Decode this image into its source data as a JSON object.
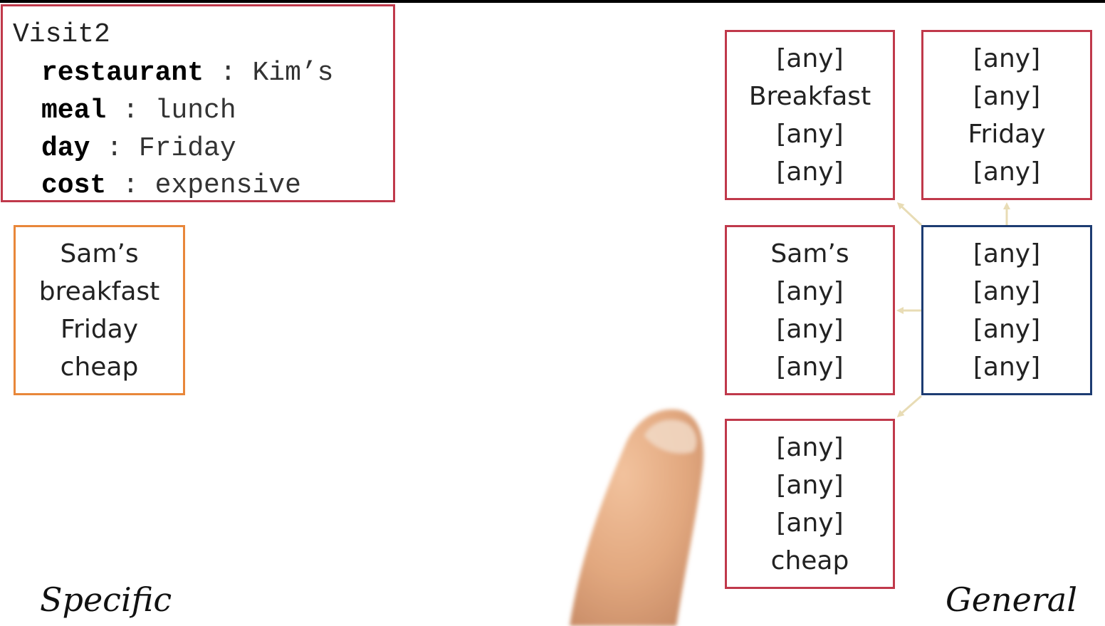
{
  "visit": {
    "title": "Visit2",
    "fields": [
      {
        "key": "restaurant",
        "value": "Kim’s"
      },
      {
        "key": "meal",
        "value": "lunch"
      },
      {
        "key": "day",
        "value": "Friday"
      },
      {
        "key": "cost",
        "value": "expensive"
      }
    ]
  },
  "specific_box": [
    "Sam’s",
    "breakfast",
    "Friday",
    "cheap"
  ],
  "general": {
    "top_left": [
      "[any]",
      "Breakfast",
      "[any]",
      "[any]"
    ],
    "top_right": [
      "[any]",
      "[any]",
      "Friday",
      "[any]"
    ],
    "mid_left": [
      "Sam’s",
      "[any]",
      "[any]",
      "[any]"
    ],
    "mid_right": [
      "[any]",
      "[any]",
      "[any]",
      "[any]"
    ],
    "bottom_left": [
      "[any]",
      "[any]",
      "[any]",
      "cheap"
    ]
  },
  "labels": {
    "specific": "Specific",
    "general": "General"
  },
  "colors": {
    "hypothesis_border": "#c0394b",
    "most_general_border": "#1d3c72",
    "specific_border": "#e8873a",
    "arrow": "#e8dcb5",
    "finger": "#e1a77e"
  }
}
